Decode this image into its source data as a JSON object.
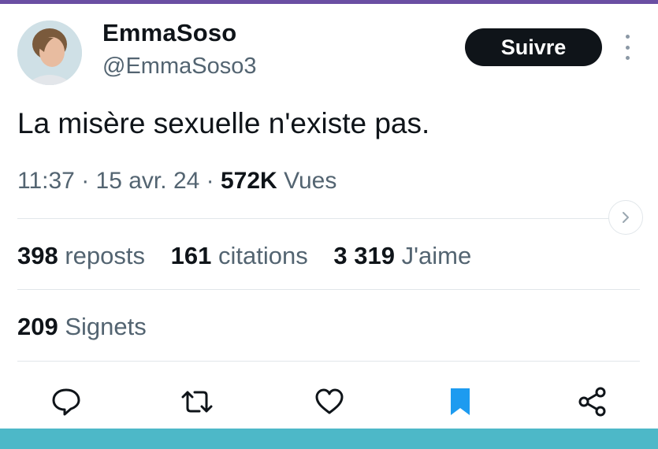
{
  "tweet": {
    "author_name": "EmmaSoso",
    "author_handle": "@EmmaSoso3",
    "follow_label": "Suivre",
    "text": "La misère sexuelle n'existe pas.",
    "time": "11:37",
    "date": "15 avr. 24",
    "views_count": "572K",
    "views_label": "Vues",
    "separator": "·"
  },
  "stats": {
    "reposts_count": "398",
    "reposts_label": "reposts",
    "quotes_count": "161",
    "quotes_label": "citations",
    "likes_count": "3 319",
    "likes_label": "J'aime",
    "bookmarks_count": "209",
    "bookmarks_label": "Signets"
  },
  "actions": [
    "reply-icon",
    "repost-icon",
    "like-icon",
    "bookmark-icon",
    "share-icon"
  ],
  "colors": {
    "text_primary": "#0f1419",
    "text_secondary": "#536471",
    "bookmark_active": "#1d9bf0",
    "top_strip": "#6a4fa3",
    "bottom_strip": "#4db8c8"
  }
}
